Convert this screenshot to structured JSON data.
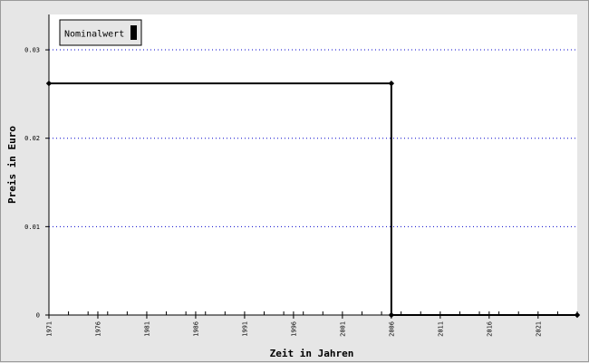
{
  "chart_data": {
    "type": "line",
    "step": true,
    "xlabel": "Zeit in Jahren",
    "ylabel": "Preis in Euro",
    "xlim": [
      1971,
      2025
    ],
    "ylim": [
      0,
      0.034
    ],
    "x_ticks": [
      1971,
      1976,
      1981,
      1986,
      1991,
      1996,
      2001,
      2006,
      2011,
      2016,
      2021
    ],
    "y_ticks": [
      0,
      0.01,
      0.02,
      0.03
    ],
    "y_tick_labels": [
      "0",
      "0.01",
      "0.02",
      "0.03"
    ],
    "grid": "horizontal dotted",
    "legend_position": "top-left",
    "series": [
      {
        "name": "Nominalwert",
        "color": "#000000",
        "points": [
          {
            "x": 1971,
            "y": 0.0262
          },
          {
            "x": 2006,
            "y": 0.0262
          },
          {
            "x": 2006,
            "y": 0
          },
          {
            "x": 2025,
            "y": 0
          }
        ]
      }
    ],
    "colors": {
      "background": "#e6e6e6",
      "plot_background": "#ffffff",
      "grid": "#0000cc",
      "line": "#000000"
    }
  }
}
